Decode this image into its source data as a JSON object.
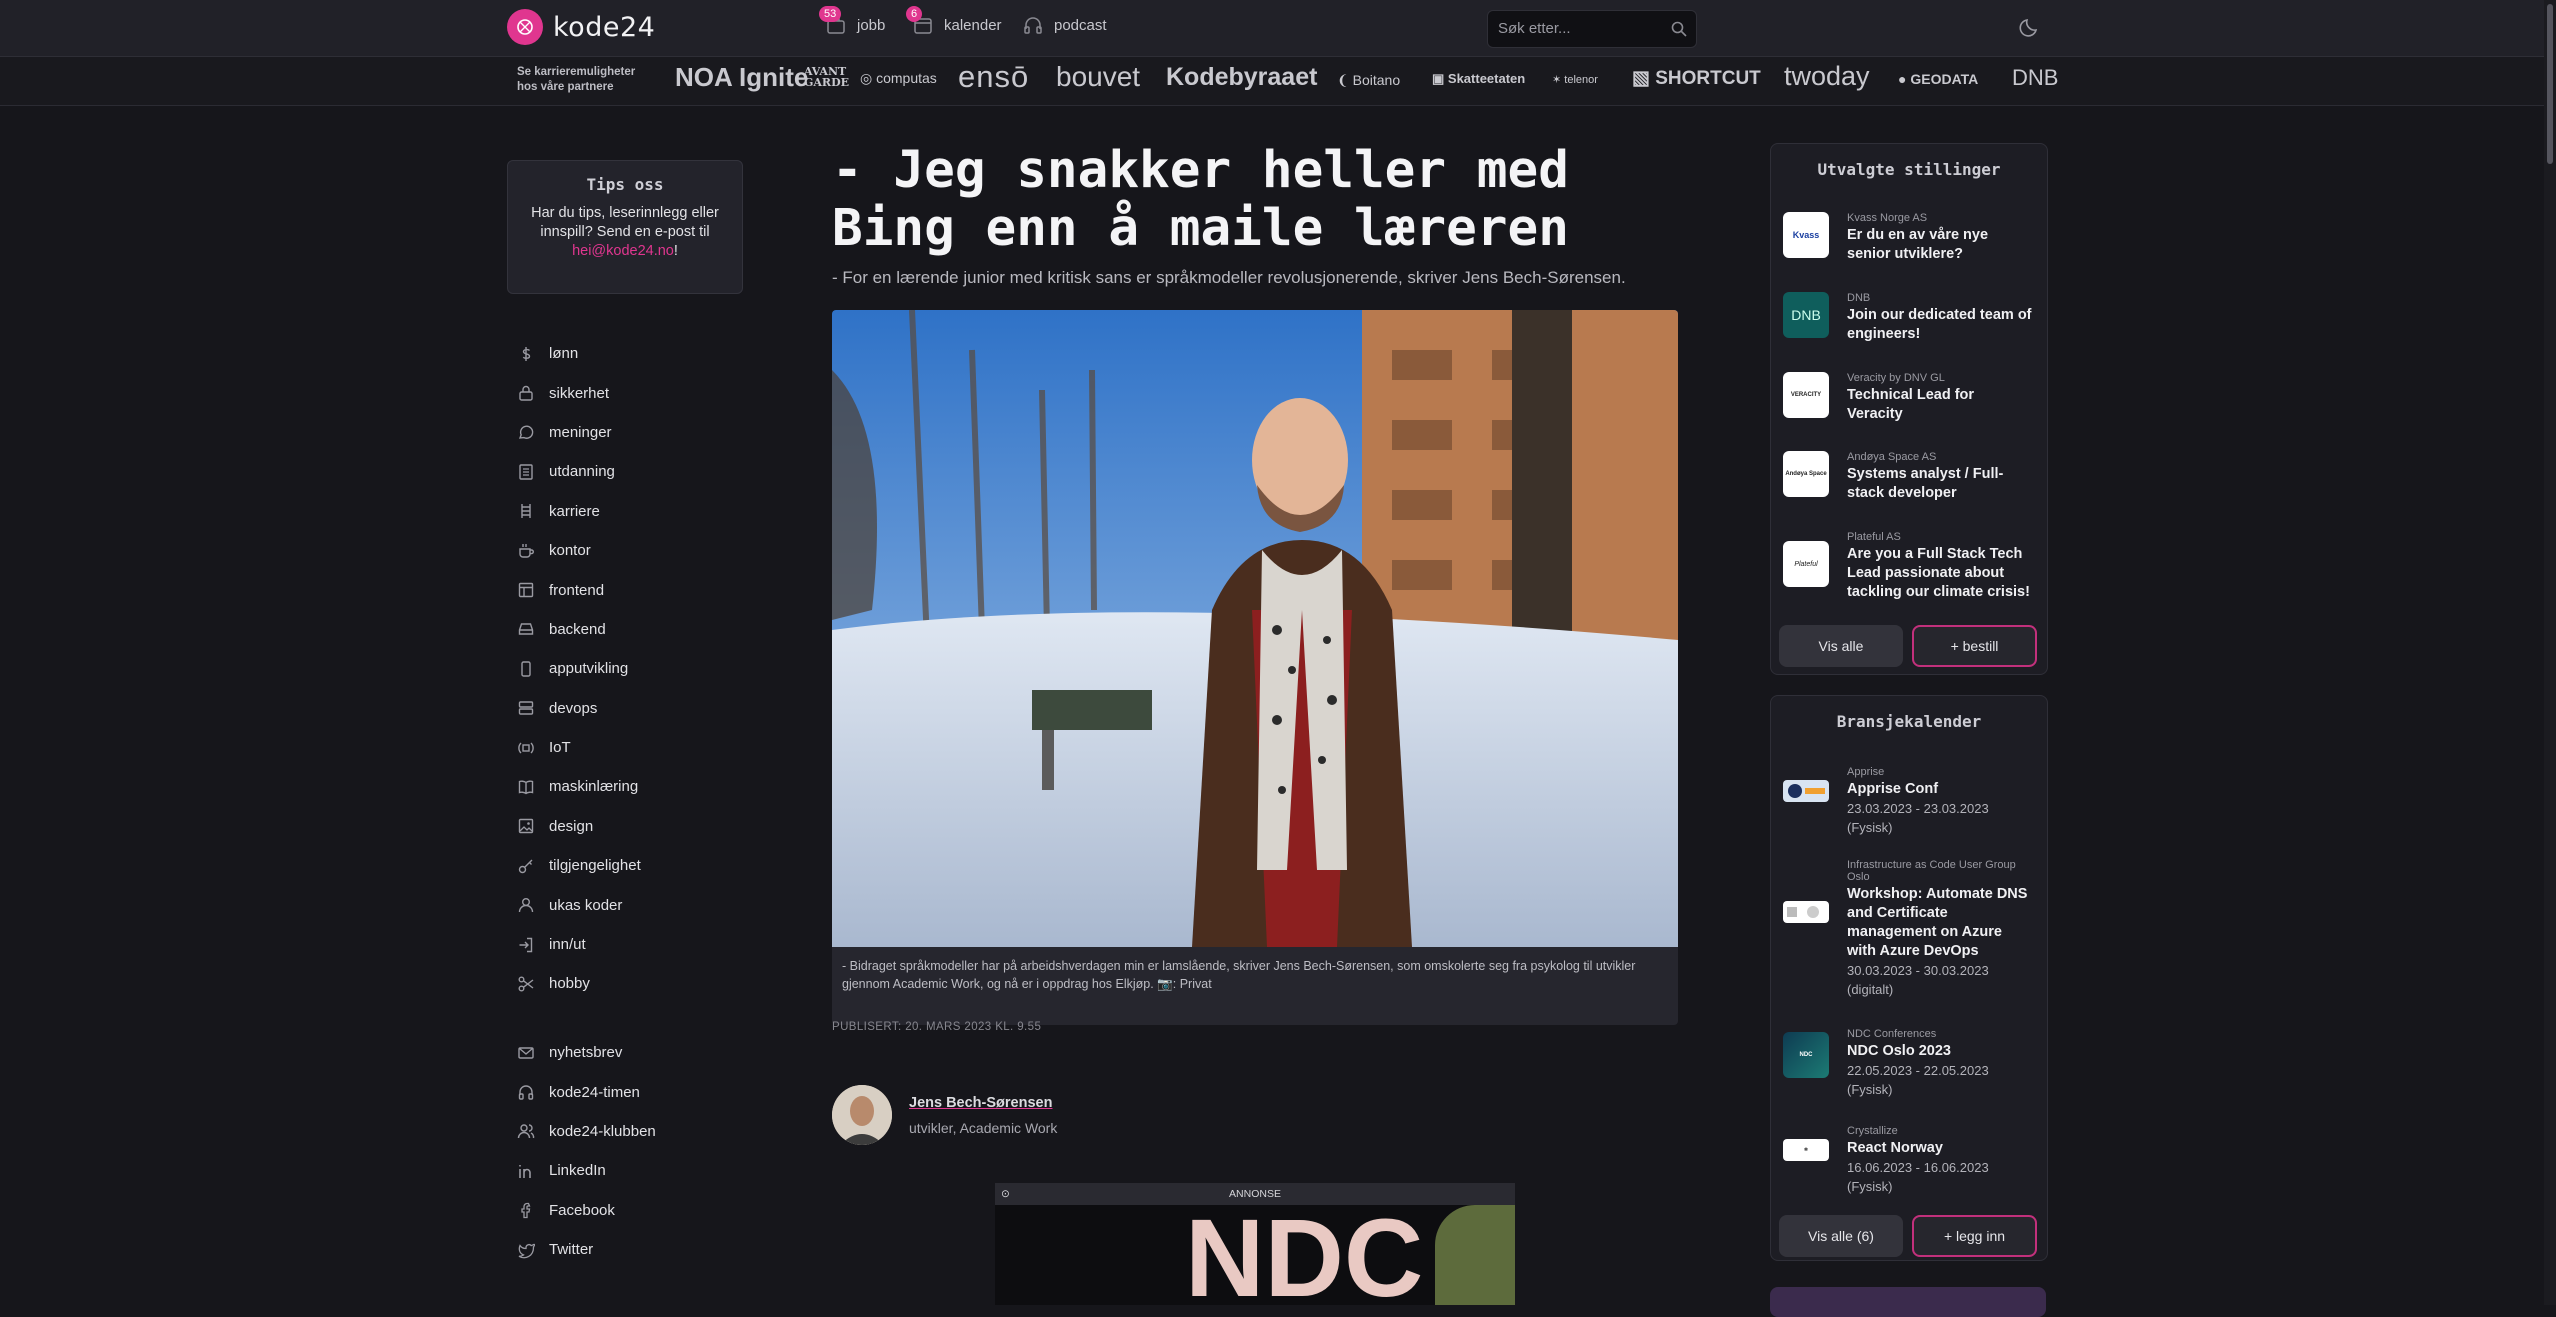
{
  "colors": {
    "accent": "#e0368f",
    "background": "#16161b",
    "panel": "#1d1d24"
  },
  "header": {
    "logo_text": "kode24",
    "nav": [
      {
        "label": "jobb",
        "badge": "53",
        "icon": "briefcase-icon"
      },
      {
        "label": "kalender",
        "badge": "6",
        "icon": "calendar-icon"
      },
      {
        "label": "podcast",
        "icon": "headphones-icon"
      }
    ],
    "search_placeholder": "Søk etter...",
    "theme_icon": "moon-icon"
  },
  "partners": {
    "label_line1": "Se karrieremuligheter",
    "label_line2": "hos våre partnere",
    "logos": [
      "NOA Ignite",
      "AVANT GARDE",
      "computas",
      "ensō",
      "bouvet",
      "Kodebyraaet",
      "Boitano",
      "Skatteetaten",
      "telenor",
      "SHORTCUT",
      "twoday",
      "GEODATA",
      "DNB"
    ]
  },
  "tips": {
    "title": "Tips oss",
    "text": "Har du tips, leserinnlegg eller innspill? Send en e-post til",
    "email": "hei@kode24.no",
    "end": "!"
  },
  "categories": [
    {
      "label": "lønn",
      "icon": "dollar-icon"
    },
    {
      "label": "sikkerhet",
      "icon": "lock-icon"
    },
    {
      "label": "meninger",
      "icon": "chat-bubble-icon"
    },
    {
      "label": "utdanning",
      "icon": "building-icon"
    },
    {
      "label": "karriere",
      "icon": "ladder-icon"
    },
    {
      "label": "kontor",
      "icon": "coffee-cup-icon"
    },
    {
      "label": "frontend",
      "icon": "layout-icon"
    },
    {
      "label": "backend",
      "icon": "server-drive-icon"
    },
    {
      "label": "apputvikling",
      "icon": "phone-icon"
    },
    {
      "label": "devops",
      "icon": "server-stack-icon"
    },
    {
      "label": "IoT",
      "icon": "iot-icon"
    },
    {
      "label": "maskinlæring",
      "icon": "book-icon"
    },
    {
      "label": "design",
      "icon": "image-icon"
    },
    {
      "label": "tilgjengelighet",
      "icon": "key-icon"
    },
    {
      "label": "ukas koder",
      "icon": "user-icon"
    },
    {
      "label": "inn/ut",
      "icon": "login-icon"
    },
    {
      "label": "hobby",
      "icon": "scissors-icon"
    }
  ],
  "secondary": [
    {
      "label": "nyhetsbrev",
      "icon": "mail-icon"
    },
    {
      "label": "kode24-timen",
      "icon": "headphones-icon"
    },
    {
      "label": "kode24-klubben",
      "icon": "users-icon"
    },
    {
      "label": "LinkedIn",
      "icon": "linkedin-icon"
    },
    {
      "label": "Facebook",
      "icon": "facebook-icon"
    },
    {
      "label": "Twitter",
      "icon": "twitter-icon"
    }
  ],
  "article": {
    "headline": "- Jeg snakker heller med Bing enn å maile læreren",
    "lede": "- For en lærende junior med kritisk sans er språkmodeller revolusjonerende, skriver Jens Bech-Sørensen.",
    "caption": "- Bidraget språkmodeller har på arbeidshverdagen min er lamslående, skriver Jens Bech-Sørensen, som omskolerte seg fra psykolog til utvikler gjennom Academic Work, og nå er i oppdrag hos Elkjøp. 📷: Privat",
    "published": "PUBLISERT: 20. MARS 2023 KL. 9.55",
    "author_name": "Jens Bech-Sørensen",
    "author_role": "utvikler, Academic Work",
    "ad_label": "ANNONSE",
    "ad_text": "NDC"
  },
  "jobs": {
    "title": "Utvalgte stillinger",
    "items": [
      {
        "company": "Kvass Norge AS",
        "title": "Er du en av våre nye senior utviklere?",
        "logo": "Kvass"
      },
      {
        "company": "DNB",
        "title": "Join our dedicated team of engineers!",
        "logo": "DNB"
      },
      {
        "company": "Veracity by DNV GL",
        "title": "Technical Lead for Veracity",
        "logo": "VERACITY"
      },
      {
        "company": "Andøya Space AS",
        "title": "Systems analyst / Full-stack developer",
        "logo": "Andøya Space"
      },
      {
        "company": "Plateful AS",
        "title": "Are you a Full Stack Tech Lead passionate about tackling our climate crisis!",
        "logo": "Plateful"
      }
    ],
    "btn_all": "Vis alle",
    "btn_order": "+ bestill"
  },
  "calendar": {
    "title": "Bransjekalender",
    "items": [
      {
        "org": "Apprise",
        "title": "Apprise Conf",
        "date": "23.03.2023 - 23.03.2023",
        "mode": "(Fysisk)"
      },
      {
        "org": "Infrastructure as Code User Group Oslo",
        "title": "Workshop: Automate DNS and Certificate management on Azure with Azure DevOps",
        "date": "30.03.2023 - 30.03.2023",
        "mode": "(digitalt)"
      },
      {
        "org": "NDC Conferences",
        "title": "NDC Oslo 2023",
        "date": "22.05.2023 - 22.05.2023",
        "mode": "(Fysisk)"
      },
      {
        "org": "Crystallize",
        "title": "React Norway",
        "date": "16.06.2023 - 16.06.2023",
        "mode": "(Fysisk)"
      }
    ],
    "btn_all": "Vis alle (6)",
    "btn_add": "+ legg inn"
  }
}
